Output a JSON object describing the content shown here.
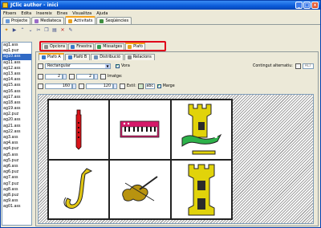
{
  "window": {
    "title": "JClic author - inici"
  },
  "menu": [
    "Fitxers",
    "Edita",
    "Insereix",
    "Eines",
    "Visualitza",
    "Ajuda"
  ],
  "app_tabs": [
    {
      "label": "Projecte",
      "icon": "project-icon"
    },
    {
      "label": "Mediateca",
      "icon": "media-icon"
    },
    {
      "label": "Activitats",
      "icon": "activities-icon",
      "selected": true
    },
    {
      "label": "Seqüències",
      "icon": "sequences-icon"
    }
  ],
  "activity_list": {
    "items": [
      "ag1.ass",
      "ag1.puz",
      "ag10.ass",
      "ag11.ass",
      "ag12.ass",
      "ag13.ass",
      "ag14.ass",
      "ag15.ass",
      "ag16.ass",
      "ag17.ass",
      "ag18.ass",
      "ag19.ass",
      "ag2.puz",
      "ag20.ass",
      "ag21.ass",
      "ag22.ass",
      "ag3.ass",
      "ag4.ass",
      "ag4.puz",
      "ag5.ass",
      "ag5.puz",
      "ag6.ass",
      "ag6.puz",
      "ag7.ass",
      "ag7.puz",
      "ag8.ass",
      "ag8.puz",
      "ag9.ass",
      "ag01.ass"
    ],
    "selected": "ag10.ass"
  },
  "section_tabs": [
    {
      "label": "Opcions"
    },
    {
      "label": "Finestra"
    },
    {
      "label": "Missatges"
    },
    {
      "label": "Plafó",
      "selected": true
    }
  ],
  "panel_tabs": [
    {
      "label": "Plafó A",
      "selected": true
    },
    {
      "label": "Plafó B"
    },
    {
      "label": "Distribució"
    },
    {
      "label": "Relacions"
    }
  ],
  "props": {
    "shape": "Rectangular",
    "border_label": "Vora",
    "border_checked": true,
    "rows": "2",
    "cols": "2",
    "width": "160",
    "height": "120",
    "image_label": "Imatge:",
    "style_label": "Estil:",
    "style_value": "abc",
    "margin_label": "Marge",
    "margin_checked": true,
    "alt_content_label": "Contingut alternatiu:",
    "alt_value": "ALT"
  },
  "cells": [
    {
      "icon": "recorder-icon"
    },
    {
      "icon": "keyboard-icon"
    },
    {
      "icon": "castle-dragon-icon"
    },
    {
      "icon": "saxophone-icon"
    },
    {
      "icon": "violin-icon"
    },
    {
      "icon": "castle-icon"
    }
  ]
}
